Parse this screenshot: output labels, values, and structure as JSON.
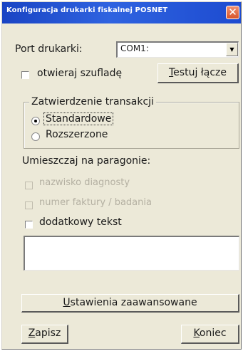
{
  "window": {
    "title": "Konfiguracja drukarki fiskalnej POSNET",
    "close_glyph": "✕"
  },
  "printer_port": {
    "label": "Port drukarki:",
    "value": "COM1:",
    "arrow_glyph": "▼"
  },
  "open_drawer": {
    "label": "otwieraj szufladę",
    "checked": false
  },
  "test_connection_button": "Testuj łącze",
  "transaction_group": {
    "legend": "Zatwierdzenie transakcji",
    "options": [
      {
        "label": "Standardowe",
        "selected": true
      },
      {
        "label": "Rozszerzone",
        "selected": false
      }
    ]
  },
  "receipt_section": {
    "heading": "Umieszczaj na paragonie:",
    "options": [
      {
        "label": "nazwisko diagnosty",
        "checked": false,
        "enabled": false
      },
      {
        "label": "numer faktury / badania",
        "checked": false,
        "enabled": false
      },
      {
        "label": "dodatkowy tekst",
        "checked": false,
        "enabled": true
      }
    ],
    "extra_text_value": ""
  },
  "advanced_settings_button": "Ustawienia zaawansowane",
  "save_button": "Zapisz",
  "end_button": "Koniec",
  "colors": {
    "titlebar": "#1d4bd0",
    "close_button": "#d8542a",
    "face": "#ece9d8",
    "disabled_text": "#b4b0a2"
  }
}
